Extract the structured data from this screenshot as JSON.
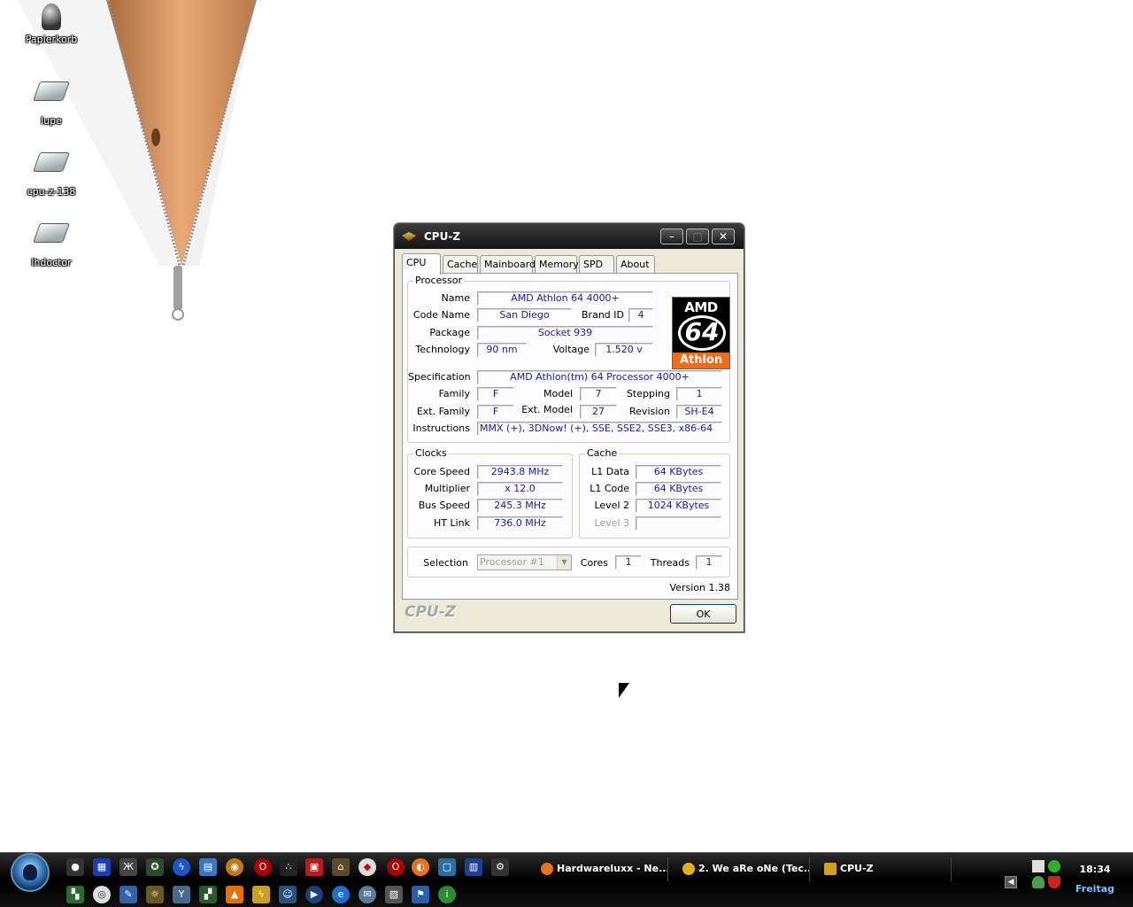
{
  "desktop": {
    "icons": [
      {
        "label": "Papierkorb",
        "icon": "recycle-bin-icon"
      },
      {
        "label": "lupe",
        "icon": "shortcut-icon"
      },
      {
        "label": "cpu-z-138",
        "icon": "shortcut-icon"
      },
      {
        "label": "lhdoctor",
        "icon": "shortcut-icon"
      }
    ]
  },
  "window": {
    "title": "CPU-Z",
    "controls": {
      "minimize": "–",
      "maximize": "□",
      "close": "✕"
    },
    "tabs": [
      "CPU",
      "Cache",
      "Mainboard",
      "Memory",
      "SPD",
      "About"
    ],
    "active_tab": "CPU",
    "processor": {
      "legend": "Processor",
      "name_label": "Name",
      "name": "AMD Athlon 64 4000+",
      "codename_label": "Code Name",
      "codename": "San Diego",
      "brandid_label": "Brand ID",
      "brandid": "4",
      "package_label": "Package",
      "package": "Socket 939",
      "technology_label": "Technology",
      "technology": "90 nm",
      "voltage_label": "Voltage",
      "voltage": "1.520 v",
      "spec_label": "Specification",
      "spec": "AMD Athlon(tm) 64 Processor 4000+",
      "family_label": "Family",
      "family": "F",
      "model_label": "Model",
      "model": "7",
      "stepping_label": "Stepping",
      "stepping": "1",
      "extfamily_label": "Ext. Family",
      "extfamily": "F",
      "extmodel_label": "Ext. Model",
      "extmodel": "27",
      "revision_label": "Revision",
      "revision": "SH-E4",
      "instructions_label": "Instructions",
      "instructions": "MMX (+), 3DNow! (+), SSE, SSE2, SSE3, x86-64"
    },
    "logo": {
      "amd": "AMD",
      "sixtyfour": "64",
      "athlon": "Athlon"
    },
    "clocks": {
      "legend": "Clocks",
      "core_label": "Core Speed",
      "core": "2943.8 MHz",
      "mult_label": "Multiplier",
      "mult": "x 12.0",
      "bus_label": "Bus Speed",
      "bus": "245.3 MHz",
      "ht_label": "HT Link",
      "ht": "736.0 MHz"
    },
    "cache": {
      "legend": "Cache",
      "l1d_label": "L1 Data",
      "l1d": "64 KBytes",
      "l1c_label": "L1 Code",
      "l1c": "64 KBytes",
      "l2_label": "Level 2",
      "l2": "1024 KBytes",
      "l3_label": "Level 3",
      "l3": ""
    },
    "selection": {
      "label": "Selection",
      "value": "Processor #1",
      "cores_label": "Cores",
      "cores": "1",
      "threads_label": "Threads",
      "threads": "1"
    },
    "version": "Version 1.38",
    "brand": "CPU-Z",
    "ok": "OK"
  },
  "taskbar": {
    "tasks": [
      {
        "label": "Hardwareluxx - Ne...",
        "icon": "firefox-icon",
        "color": "#e8731c"
      },
      {
        "label": "2. We aRe oNe (Tec...",
        "icon": "winamp-icon",
        "color": "#e0b020"
      },
      {
        "label": "CPU-Z",
        "icon": "cpuz-icon",
        "color": "#d4a017"
      }
    ],
    "clock": "18:34",
    "day": "Freitag"
  },
  "colors": {
    "value_text": "#1a1aa6",
    "amd_orange": "#f26c18",
    "window_bg": "#ece9d8"
  }
}
